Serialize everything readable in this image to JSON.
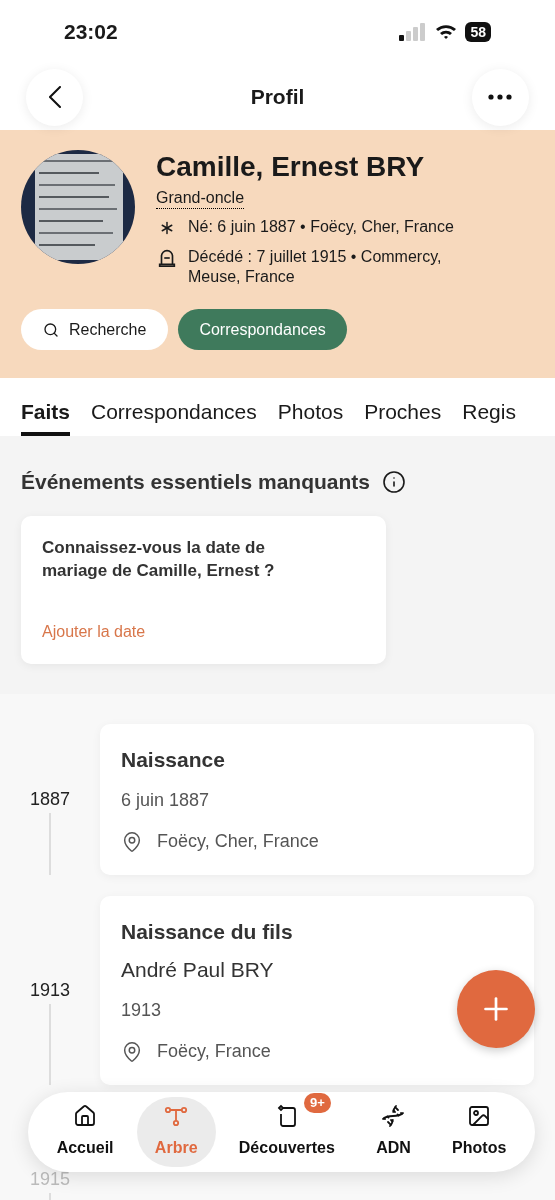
{
  "status_bar": {
    "time": "23:02",
    "battery": "58"
  },
  "header": {
    "title": "Profil"
  },
  "profile": {
    "name": "Camille, Ernest BRY",
    "relation": "Grand-oncle",
    "facts": [
      {
        "kind": "birth",
        "text": "Né: 6 juin 1887 • Foëcy, Cher, France"
      },
      {
        "kind": "death",
        "text": "Décédé : 7 juillet 1915 • Commercy, Meuse, France"
      }
    ],
    "buttons": [
      {
        "kind": "search",
        "label": "Recherche"
      },
      {
        "kind": "primary",
        "label": "Correspondances"
      }
    ]
  },
  "tabs": [
    {
      "label": "Faits",
      "selected": true
    },
    {
      "label": "Correspondances",
      "selected": false
    },
    {
      "label": "Photos",
      "selected": false
    },
    {
      "label": "Proches",
      "selected": false
    },
    {
      "label": "Regis",
      "selected": false
    }
  ],
  "missing": {
    "title": "Événements essentiels manquants",
    "question": "Connaissez-vous la date de mariage de Camille, Ernest ?",
    "action": "Ajouter la date"
  },
  "timeline": [
    {
      "year": "1887",
      "title": "Naissance",
      "date": "6 juin 1887",
      "place": "Foëcy, Cher, France"
    },
    {
      "year": "1913",
      "title": "Naissance du fils",
      "person": "André Paul BRY",
      "date": "1913",
      "place": "Foëcy, France"
    },
    {
      "year": "1915"
    }
  ],
  "nav": [
    {
      "kind": "home",
      "label": "Accueil",
      "selected": false
    },
    {
      "kind": "tree",
      "label": "Arbre",
      "selected": true
    },
    {
      "kind": "discover",
      "label": "Découvertes",
      "selected": false,
      "badge": "9+"
    },
    {
      "kind": "dna",
      "label": "ADN",
      "selected": false
    },
    {
      "kind": "photos",
      "label": "Photos",
      "selected": false
    }
  ]
}
